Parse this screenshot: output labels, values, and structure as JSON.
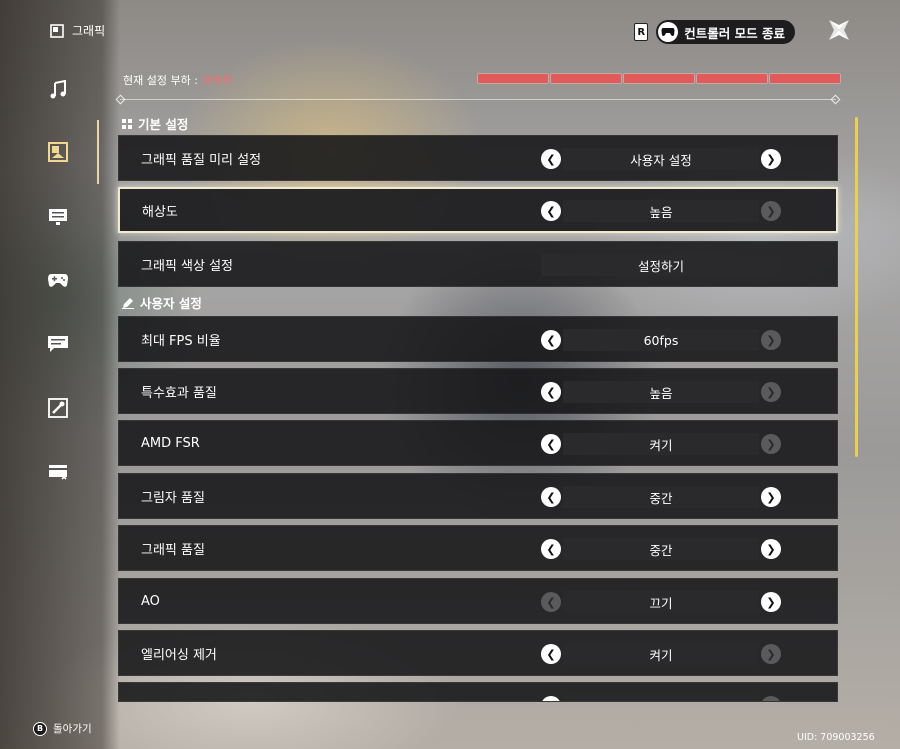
{
  "sidebar": {
    "title": "그래픽",
    "items": [
      {
        "icon": "music-note-icon"
      },
      {
        "icon": "image-icon",
        "active": true
      },
      {
        "icon": "monitor-icon"
      },
      {
        "icon": "gamepad-icon"
      },
      {
        "icon": "message-icon"
      },
      {
        "icon": "tools-icon"
      },
      {
        "icon": "card-icon"
      }
    ]
  },
  "header": {
    "r_badge": "R",
    "exit_controller_label": "컨트롤러 모드 종료",
    "close_icon": "close-x-icon"
  },
  "load": {
    "label": "현재 설정 부하 :",
    "value": "과부하",
    "segments": 5,
    "filled": 5,
    "color": "#e25a5a"
  },
  "sections": {
    "basic": "기본 설정",
    "custom": "사용자 설정"
  },
  "rows": {
    "preset": {
      "label": "그래픽 품질 미리 설정",
      "value": "사용자 설정"
    },
    "resolution": {
      "label": "해상도",
      "value": "높음"
    },
    "color": {
      "label": "그래픽 색상 설정",
      "button": "설정하기"
    },
    "fps": {
      "label": "최대 FPS 비율",
      "value": "60fps"
    },
    "effects": {
      "label": "특수효과 품질",
      "value": "높음"
    },
    "fsr": {
      "label": "AMD FSR",
      "value": "켜기"
    },
    "shadow": {
      "label": "그림자 품질",
      "value": "중간"
    },
    "quality": {
      "label": "그래픽 품질",
      "value": "중간"
    },
    "ao": {
      "label": "AO",
      "value": "끄기"
    },
    "aa": {
      "label": "엘리어싱 제거",
      "value": "켜기"
    }
  },
  "footer": {
    "back_key": "B",
    "back_label": "돌아가기",
    "uid": "UID: 709003256"
  },
  "colors": {
    "accent": "#f0d890",
    "overload": "#ff6b6b"
  }
}
